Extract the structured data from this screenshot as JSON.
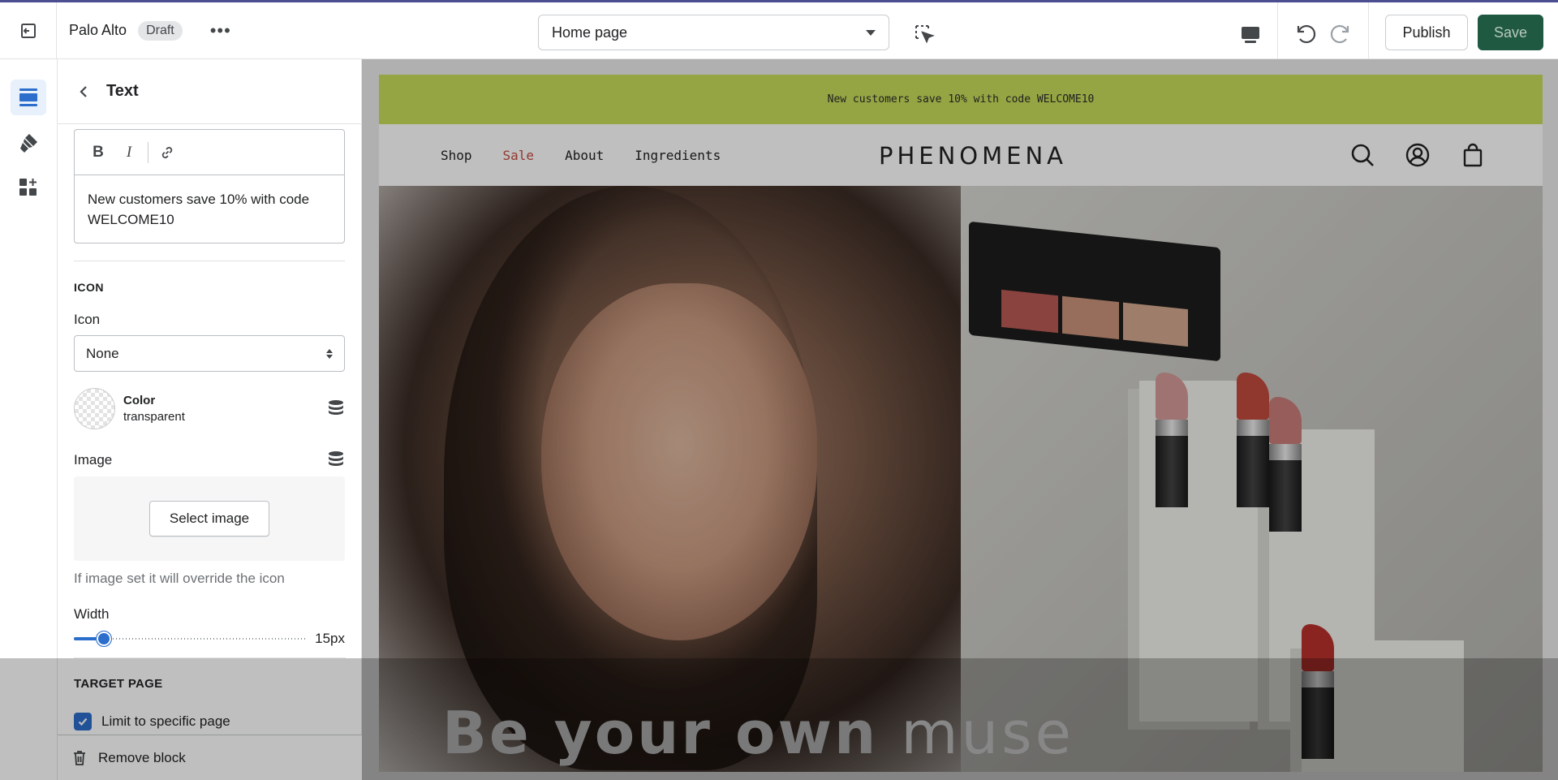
{
  "topbar": {
    "store_name": "Palo Alto",
    "status_badge": "Draft",
    "more_label": "•••",
    "page_selector": "Home page",
    "publish_label": "Publish",
    "save_label": "Save"
  },
  "rail": {
    "items": [
      "sections-icon",
      "theme-settings-icon",
      "apps-icon"
    ],
    "active_color": "#2c6ecb"
  },
  "panel": {
    "title": "Text",
    "rich_text": {
      "bold": "B",
      "italic": "I",
      "value": "New customers save 10% with code WELCOME10"
    },
    "icon_section": {
      "heading": "ICON",
      "icon_label": "Icon",
      "icon_value": "None",
      "color_label": "Color",
      "color_value": "transparent"
    },
    "image": {
      "label": "Image",
      "button": "Select image",
      "help": "If image set it will override the icon"
    },
    "width": {
      "label": "Width",
      "value": "15px",
      "fraction": 0.13
    },
    "target": {
      "heading": "TARGET PAGE",
      "checkbox_label": "Limit to specific page",
      "checked": true
    },
    "footer": {
      "remove_label": "Remove block"
    }
  },
  "preview": {
    "announcement": "New customers save 10% with code WELCOME10",
    "announcement_color": "#c7dd5a",
    "nav": [
      "Shop",
      "Sale",
      "About",
      "Ingredients"
    ],
    "sale_color": "#c34b3f",
    "logo": "PHENOMENA",
    "hero_text_main": "Be your own",
    "hero_text_accent": "muse"
  },
  "colors": {
    "save_button": "#1f5942",
    "accent": "#2c6ecb"
  }
}
